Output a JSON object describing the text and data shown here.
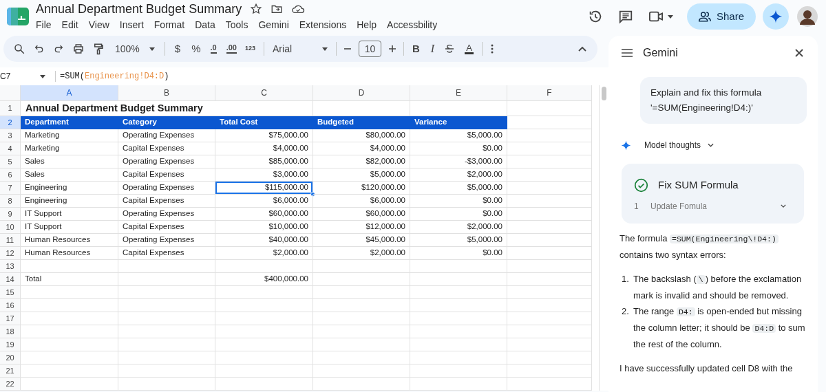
{
  "app": {
    "title": "Annual Department Budget Summary"
  },
  "menu": [
    "File",
    "Edit",
    "View",
    "Insert",
    "Format",
    "Data",
    "Tools",
    "Gemini",
    "Extensions",
    "Help",
    "Accessbility"
  ],
  "header": {
    "share": "Share"
  },
  "toolbar": {
    "zoom": "100%",
    "currency": "$",
    "percent": "%",
    "decrease_decimals": ".0",
    "increase_decimals": ".00",
    "number_format": "123",
    "font": "Arial",
    "font_size": "10",
    "bold": "B",
    "italic": "I",
    "text_color": "A"
  },
  "formula_bar": {
    "name_box": "C7",
    "prefix": "=SUM(",
    "reference": "Engineering!D4:D",
    "suffix": ")"
  },
  "columns": [
    {
      "label": "A",
      "selected": true
    },
    {
      "label": "B",
      "selected": false
    },
    {
      "label": "C",
      "selected": false
    },
    {
      "label": "D",
      "selected": false
    },
    {
      "label": "E",
      "selected": false
    },
    {
      "label": "F",
      "selected": false
    }
  ],
  "rows": [
    {
      "number": "1",
      "selected": false,
      "kind": "title",
      "cells": [
        {
          "text": "Annual Department Budget Summary",
          "selected": false
        }
      ]
    },
    {
      "number": "2",
      "selected": true,
      "kind": "heading",
      "cells": [
        {
          "text": "Department",
          "selected": false
        },
        {
          "text": "Category",
          "selected": false
        },
        {
          "text": "Total Cost",
          "selected": false
        },
        {
          "text": "Budgeted",
          "selected": false
        },
        {
          "text": "Variance",
          "selected": false
        }
      ]
    },
    {
      "number": "3",
      "selected": false,
      "kind": "data",
      "cells": [
        {
          "text": "Marketing",
          "selected": false
        },
        {
          "text": "Operating Expenses",
          "selected": false
        },
        {
          "text": "$75,000.00",
          "selected": false
        },
        {
          "text": "$80,000.00",
          "selected": false
        },
        {
          "text": "$5,000.00",
          "selected": false
        }
      ]
    },
    {
      "number": "4",
      "selected": false,
      "kind": "data",
      "cells": [
        {
          "text": "Marketing",
          "selected": false
        },
        {
          "text": "Capital Expenses",
          "selected": false
        },
        {
          "text": "$4,000.00",
          "selected": false
        },
        {
          "text": "$4,000.00",
          "selected": false
        },
        {
          "text": "$0.00",
          "selected": false
        }
      ]
    },
    {
      "number": "5",
      "selected": false,
      "kind": "data",
      "cells": [
        {
          "text": "Sales",
          "selected": false
        },
        {
          "text": "Operating Expenses",
          "selected": false
        },
        {
          "text": "$85,000.00",
          "selected": false
        },
        {
          "text": "$82,000.00",
          "selected": false
        },
        {
          "text": "-$3,000.00",
          "selected": false
        }
      ]
    },
    {
      "number": "6",
      "selected": false,
      "kind": "data",
      "cells": [
        {
          "text": "Sales",
          "selected": false
        },
        {
          "text": "Capital Expenses",
          "selected": false
        },
        {
          "text": "$3,000.00",
          "selected": false
        },
        {
          "text": "$5,000.00",
          "selected": false
        },
        {
          "text": "$2,000.00",
          "selected": false
        }
      ]
    },
    {
      "number": "7",
      "selected": false,
      "kind": "data",
      "cells": [
        {
          "text": "Engineering",
          "selected": false
        },
        {
          "text": "Operating Expenses",
          "selected": false
        },
        {
          "text": "$115,000.00",
          "selected": true
        },
        {
          "text": "$120,000.00",
          "selected": false
        },
        {
          "text": "$5,000.00",
          "selected": false
        }
      ]
    },
    {
      "number": "8",
      "selected": false,
      "kind": "data",
      "cells": [
        {
          "text": "Engineering",
          "selected": false
        },
        {
          "text": "Capital Expenses",
          "selected": false
        },
        {
          "text": "$6,000.00",
          "selected": false
        },
        {
          "text": "$6,000.00",
          "selected": false
        },
        {
          "text": "$0.00",
          "selected": false
        }
      ]
    },
    {
      "number": "9",
      "selected": false,
      "kind": "data",
      "cells": [
        {
          "text": "IT Support",
          "selected": false
        },
        {
          "text": "Operating Expenses",
          "selected": false
        },
        {
          "text": "$60,000.00",
          "selected": false
        },
        {
          "text": "$60,000.00",
          "selected": false
        },
        {
          "text": "$0.00",
          "selected": false
        }
      ]
    },
    {
      "number": "10",
      "selected": false,
      "kind": "data",
      "cells": [
        {
          "text": "IT Support",
          "selected": false
        },
        {
          "text": "Capital Expenses",
          "selected": false
        },
        {
          "text": "$10,000.00",
          "selected": false
        },
        {
          "text": "$12,000.00",
          "selected": false
        },
        {
          "text": "$2,000.00",
          "selected": false
        }
      ]
    },
    {
      "number": "11",
      "selected": false,
      "kind": "data",
      "cells": [
        {
          "text": "Human Resources",
          "selected": false
        },
        {
          "text": "Operating Expenses",
          "selected": false
        },
        {
          "text": "$40,000.00",
          "selected": false
        },
        {
          "text": "$45,000.00",
          "selected": false
        },
        {
          "text": "$5,000.00",
          "selected": false
        }
      ]
    },
    {
      "number": "12",
      "selected": false,
      "kind": "data",
      "cells": [
        {
          "text": "Human Resources",
          "selected": false
        },
        {
          "text": "Capital Expenses",
          "selected": false
        },
        {
          "text": "$2,000.00",
          "selected": false
        },
        {
          "text": "$2,000.00",
          "selected": false
        },
        {
          "text": "$0.00",
          "selected": false
        }
      ]
    },
    {
      "number": "13",
      "selected": false,
      "kind": "data"
    },
    {
      "number": "14",
      "selected": false,
      "kind": "data",
      "cells": [
        {
          "text": "Total",
          "selected": false
        },
        null,
        {
          "text": "$400,000.00",
          "selected": false
        }
      ]
    },
    {
      "number": "15",
      "selected": false,
      "kind": "data"
    },
    {
      "number": "16",
      "selected": false,
      "kind": "data"
    },
    {
      "number": "17",
      "selected": false,
      "kind": "data"
    },
    {
      "number": "18",
      "selected": false,
      "kind": "data"
    },
    {
      "number": "19",
      "selected": false,
      "kind": "data"
    },
    {
      "number": "20",
      "selected": false,
      "kind": "data"
    },
    {
      "number": "21",
      "selected": false,
      "kind": "data"
    },
    {
      "number": "22",
      "selected": false,
      "kind": "data"
    }
  ],
  "gemini": {
    "title": "Gemini",
    "prompt": "Explain and fix this formula '=SUM(Engineering!D4:)'",
    "thoughts_label": "Model thoughts",
    "task": {
      "title": "Fix SUM Formula",
      "done": true,
      "steps": [
        {
          "number": "1",
          "label": "Update Fomula"
        }
      ]
    },
    "response": [
      {
        "kind": "paragraph",
        "segments": [
          {
            "kind": "text",
            "text": "The formula "
          },
          {
            "kind": "code",
            "text": "=SUM(Engineering\\!D4:)"
          },
          {
            "kind": "text",
            "text": " contains two syntax errors:"
          }
        ]
      },
      {
        "kind": "list_item",
        "number": "1.",
        "segments": [
          {
            "kind": "text",
            "text": "The backslash ("
          },
          {
            "kind": "code",
            "text": "\\"
          },
          {
            "kind": "text",
            "text": ") before the exclamation mark is invalid and should be removed."
          }
        ]
      },
      {
        "kind": "list_item",
        "number": "2.",
        "segments": [
          {
            "kind": "text",
            "text": "The range "
          },
          {
            "kind": "code",
            "text": "D4:"
          },
          {
            "kind": "text",
            "text": " is open-ended but missing the column letter; it should be "
          },
          {
            "kind": "code",
            "text": "D4:D"
          },
          {
            "kind": "text",
            "text": " to sum the rest of the column."
          }
        ]
      },
      {
        "kind": "paragraph",
        "segments": [
          {
            "kind": "text",
            "text": "I have successfully updated cell D8 with the"
          }
        ]
      }
    ]
  }
}
